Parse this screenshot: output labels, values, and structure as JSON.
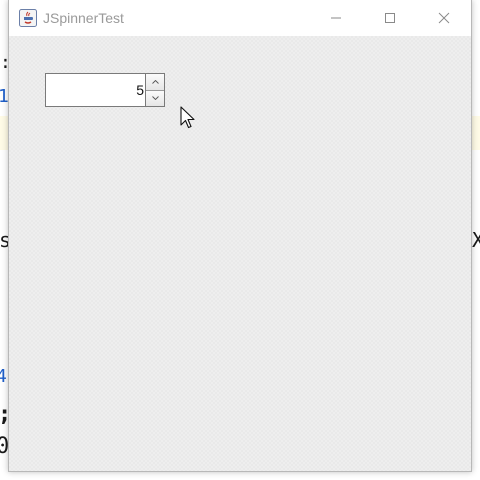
{
  "window": {
    "title": "JSpinnerTest",
    "controls": {
      "minimize": "minimize-icon",
      "maximize": "maximize-icon",
      "close": "close-icon"
    }
  },
  "spinner": {
    "value": "5",
    "up_icon": "arrow-up-icon",
    "down_icon": "arrow-down-icon"
  },
  "background_fragments": {
    "colon": ":",
    "one": "1",
    "s": "s",
    "x": "X",
    "four": "4",
    "semicolon": ";",
    "zero": "0"
  },
  "colors": {
    "window_bg": "#efefef",
    "titlebar_bg": "#ffffff",
    "title_text": "#9a9a9a",
    "code_blue": "#1f5fc9"
  }
}
